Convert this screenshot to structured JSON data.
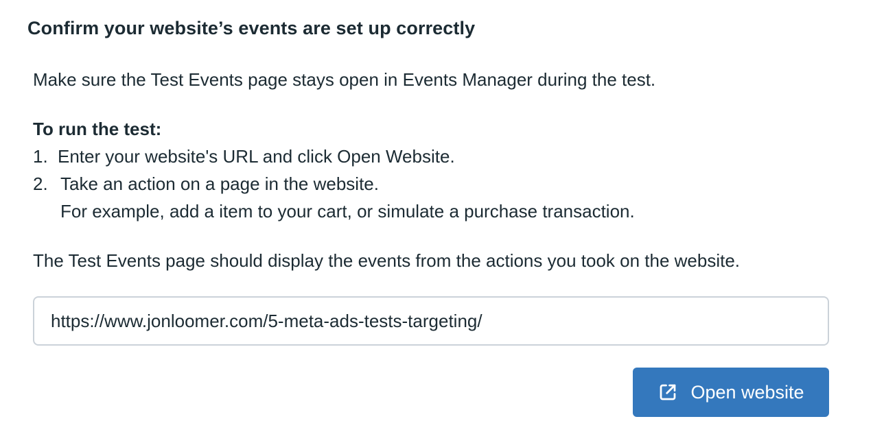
{
  "header": {
    "title": "Confirm your website’s events are set up correctly"
  },
  "instructions": {
    "intro": "Make sure the Test Events page stays open in Events Manager during the test.",
    "steps_heading": "To run the test:",
    "steps": [
      {
        "number": "1.",
        "text": "Enter your website's URL and click Open Website."
      },
      {
        "number": "2.",
        "text": "Take an action on a page in the website.",
        "subtext": "For example, add a item to your cart, or simulate a purchase transaction."
      }
    ],
    "result": "The Test Events page should display the events from the actions you took on the website."
  },
  "url_field": {
    "value": "https://www.jonloomer.com/5-meta-ads-tests-targeting/"
  },
  "open_button": {
    "label": "Open website",
    "icon": "external-link-icon",
    "color": "#3478bd"
  }
}
